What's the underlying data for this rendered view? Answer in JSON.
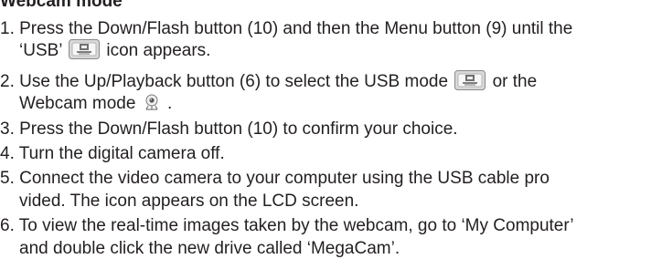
{
  "heading": "Webcam mode",
  "steps": [
    {
      "line1": "1. Press the Down/Flash button (10) and then the Menu button (9) until the",
      "line2_before": "‘USB’",
      "line2_after": "icon appears."
    },
    {
      "line1_before": "2. Use the Up/Playback button (6) to select the USB mode",
      "line1_after": "or the",
      "line2_before": "Webcam mode",
      "line2_after": "."
    },
    {
      "line1": "3. Press the Down/Flash button (10) to confirm your choice."
    },
    {
      "line1": "4. Turn the digital camera off."
    },
    {
      "line1": "5. Connect the video camera to your computer using the USB cable pro",
      "line2": "vided. The  icon appears on the LCD screen."
    },
    {
      "line1": "6. To view the real-time images taken by the webcam, go to ‘My Computer’",
      "line2": "and double click the new drive called ‘MegaCam’."
    }
  ],
  "icons": {
    "usb": "usb-mode-icon",
    "webcam": "webcam-mode-icon"
  }
}
